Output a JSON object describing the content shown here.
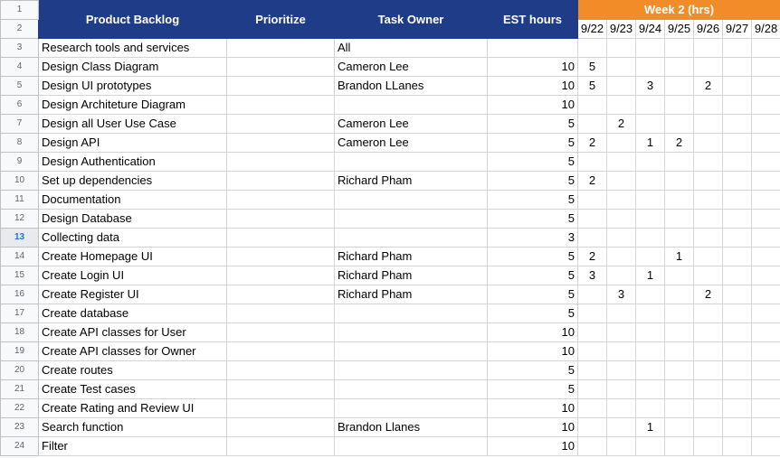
{
  "row_numbers": [
    "1",
    "2",
    "3",
    "4",
    "5",
    "6",
    "7",
    "8",
    "9",
    "10",
    "11",
    "12",
    "13",
    "14",
    "15",
    "16",
    "17",
    "18",
    "19",
    "20",
    "21",
    "22",
    "23",
    "24"
  ],
  "selected_row": "13",
  "headers": {
    "product_backlog": "Product Backlog",
    "prioritize": "Prioritize",
    "task_owner": "Task Owner",
    "est_hours": "EST hours",
    "week": "Week 2 (hrs)",
    "dates": [
      "9/22",
      "9/23",
      "9/24",
      "9/25",
      "9/26",
      "9/27",
      "9/28"
    ]
  },
  "colors": {
    "header_bg": "#1f3c88",
    "week_bg": "#f28c28",
    "selected_row": "#1a73e8"
  },
  "rows": [
    {
      "task": "Research tools and services",
      "priority": "",
      "owner": "All",
      "est": "",
      "days": [
        "",
        "",
        "",
        "",
        "",
        "",
        ""
      ]
    },
    {
      "task": "Design Class Diagram",
      "priority": "",
      "owner": "Cameron Lee",
      "est": "10",
      "days": [
        "5",
        "",
        "",
        "",
        "",
        "",
        ""
      ]
    },
    {
      "task": "Design UI prototypes",
      "priority": "",
      "owner": "Brandon LLanes",
      "est": "10",
      "days": [
        "5",
        "",
        "3",
        "",
        "2",
        "",
        ""
      ]
    },
    {
      "task": "Design Architeture Diagram",
      "priority": "",
      "owner": "",
      "est": "10",
      "days": [
        "",
        "",
        "",
        "",
        "",
        "",
        ""
      ]
    },
    {
      "task": "Design all User Use Case",
      "priority": "",
      "owner": "Cameron Lee",
      "est": "5",
      "days": [
        "",
        "2",
        "",
        "",
        "",
        "",
        ""
      ]
    },
    {
      "task": "Design API",
      "priority": "",
      "owner": "Cameron Lee",
      "est": "5",
      "days": [
        "2",
        "",
        "1",
        "2",
        "",
        "",
        ""
      ]
    },
    {
      "task": "Design Authentication",
      "priority": "",
      "owner": "",
      "est": "5",
      "days": [
        "",
        "",
        "",
        "",
        "",
        "",
        ""
      ]
    },
    {
      "task": "Set up dependencies",
      "priority": "",
      "owner": "Richard Pham",
      "est": "5",
      "days": [
        "2",
        "",
        "",
        "",
        "",
        "",
        ""
      ]
    },
    {
      "task": "Documentation",
      "priority": "",
      "owner": "",
      "est": "5",
      "days": [
        "",
        "",
        "",
        "",
        "",
        "",
        ""
      ]
    },
    {
      "task": "Design Database",
      "priority": "",
      "owner": "",
      "est": "5",
      "days": [
        "",
        "",
        "",
        "",
        "",
        "",
        ""
      ]
    },
    {
      "task": "Collecting data",
      "priority": "",
      "owner": "",
      "est": "3",
      "days": [
        "",
        "",
        "",
        "",
        "",
        "",
        ""
      ]
    },
    {
      "task": "Create Homepage UI",
      "priority": "",
      "owner": "Richard Pham",
      "est": "5",
      "days": [
        "2",
        "",
        "",
        "1",
        "",
        "",
        ""
      ]
    },
    {
      "task": "Create Login UI",
      "priority": "",
      "owner": "Richard Pham",
      "est": "5",
      "days": [
        "3",
        "",
        "1",
        "",
        "",
        "",
        ""
      ]
    },
    {
      "task": "Create Register UI",
      "priority": "",
      "owner": "Richard Pham",
      "est": "5",
      "days": [
        "",
        "3",
        "",
        "",
        "2",
        "",
        ""
      ]
    },
    {
      "task": "Create database",
      "priority": "",
      "owner": "",
      "est": "5",
      "days": [
        "",
        "",
        "",
        "",
        "",
        "",
        ""
      ]
    },
    {
      "task": "Create API classes for User",
      "priority": "",
      "owner": "",
      "est": "10",
      "days": [
        "",
        "",
        "",
        "",
        "",
        "",
        ""
      ]
    },
    {
      "task": "Create API classes for Owner",
      "priority": "",
      "owner": "",
      "est": "10",
      "days": [
        "",
        "",
        "",
        "",
        "",
        "",
        ""
      ]
    },
    {
      "task": "Create routes",
      "priority": "",
      "owner": "",
      "est": "5",
      "days": [
        "",
        "",
        "",
        "",
        "",
        "",
        ""
      ]
    },
    {
      "task": "Create Test cases",
      "priority": "",
      "owner": "",
      "est": "5",
      "days": [
        "",
        "",
        "",
        "",
        "",
        "",
        ""
      ]
    },
    {
      "task": "Create Rating and Review UI",
      "priority": "",
      "owner": "",
      "est": "10",
      "days": [
        "",
        "",
        "",
        "",
        "",
        "",
        ""
      ]
    },
    {
      "task": "Search function",
      "priority": "",
      "owner": "Brandon Llanes",
      "est": "10",
      "days": [
        "",
        "",
        "1",
        "",
        "",
        "",
        ""
      ]
    },
    {
      "task": "Filter",
      "priority": "",
      "owner": "",
      "est": "10",
      "days": [
        "",
        "",
        "",
        "",
        "",
        "",
        ""
      ]
    }
  ]
}
